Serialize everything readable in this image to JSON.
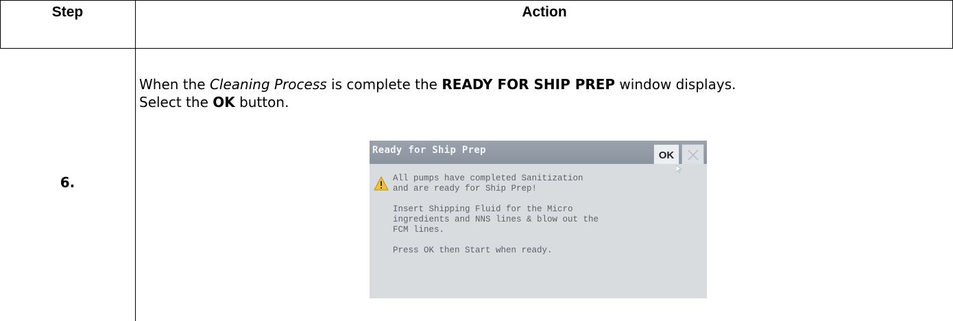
{
  "table": {
    "header_step": "Step",
    "header_action": "Action",
    "step_number": "6.",
    "instruction": {
      "p1": "When the ",
      "p2": "Cleaning Process",
      "p3": " is complete the ",
      "p4": "READY FOR SHIP PREP",
      "p5": " window displays.",
      "p6": "Select the ",
      "p7": "OK",
      "p8": " button."
    }
  },
  "dialog": {
    "title": "Ready for Ship Prep",
    "ok_label": "OK",
    "lines": [
      "All pumps have completed Sanitization",
      "and are ready for Ship Prep!",
      "",
      "Insert Shipping Fluid for the Micro",
      "ingredients and NNS lines & blow out the",
      "FCM lines.",
      "",
      "Press OK then Start when ready."
    ],
    "warning_icon": "warning-icon",
    "close_icon": "close-icon",
    "colors": {
      "titlebar": "#8f98a3",
      "body": "#d8dcdf",
      "text": "#5d6268",
      "warning": "#f2c230"
    }
  }
}
